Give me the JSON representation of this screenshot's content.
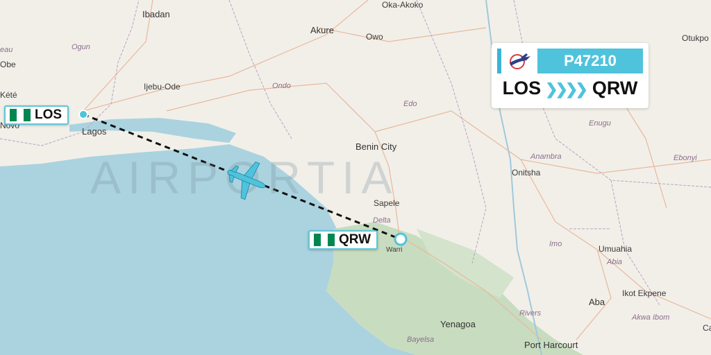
{
  "flight": {
    "number": "P47210",
    "origin": "LOS",
    "destination": "QRW",
    "route_arrows": "❯❯❯❯"
  },
  "airports": {
    "origin": {
      "code": "LOS",
      "flag": "nigeria-flag"
    },
    "destination": {
      "code": "QRW",
      "flag": "nigeria-flag"
    }
  },
  "watermark": "AIRPORTIA",
  "colors": {
    "accent": "#4fc3dc",
    "water": "#aad3df",
    "land": "#f2efe9",
    "wetland": "#c8dcc0",
    "route": "#111111",
    "flag_green": "#008751"
  },
  "icons": {
    "airline_logo": "airline-logo-icon",
    "plane": "plane-icon",
    "origin_marker": "origin-marker-icon",
    "destination_marker": "destination-marker-icon"
  },
  "map_labels": {
    "cities": [
      "Ibadan",
      "Oka-Akoko",
      "Akure",
      "Owo",
      "Otukpo",
      "Ijebu-Ode",
      "Lagos",
      "Novo",
      "Benin City",
      "Sapele",
      "Warri",
      "Onitsha",
      "Umuahia",
      "Aba",
      "Ikot Ekpene",
      "Yenagoa",
      "Port Harcourt",
      "Obe",
      "Kété",
      "Ca"
    ],
    "regions": [
      "Ogun",
      "Ondo",
      "Edo",
      "Enugu",
      "Anambra",
      "Ebonyi",
      "Imo",
      "Abia",
      "Rivers",
      "Akwa Ibom",
      "Bayelsa",
      "Delta",
      "eau"
    ]
  }
}
